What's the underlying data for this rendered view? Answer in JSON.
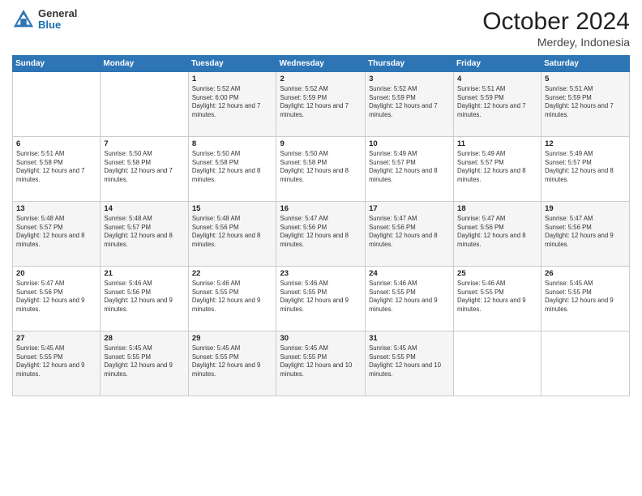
{
  "logo": {
    "general": "General",
    "blue": "Blue"
  },
  "title": "October 2024",
  "location": "Merdey, Indonesia",
  "days_header": [
    "Sunday",
    "Monday",
    "Tuesday",
    "Wednesday",
    "Thursday",
    "Friday",
    "Saturday"
  ],
  "weeks": [
    [
      {
        "day": "",
        "sunrise": "",
        "sunset": "",
        "daylight": ""
      },
      {
        "day": "",
        "sunrise": "",
        "sunset": "",
        "daylight": ""
      },
      {
        "day": "1",
        "sunrise": "Sunrise: 5:52 AM",
        "sunset": "Sunset: 6:00 PM",
        "daylight": "Daylight: 12 hours and 7 minutes."
      },
      {
        "day": "2",
        "sunrise": "Sunrise: 5:52 AM",
        "sunset": "Sunset: 5:59 PM",
        "daylight": "Daylight: 12 hours and 7 minutes."
      },
      {
        "day": "3",
        "sunrise": "Sunrise: 5:52 AM",
        "sunset": "Sunset: 5:59 PM",
        "daylight": "Daylight: 12 hours and 7 minutes."
      },
      {
        "day": "4",
        "sunrise": "Sunrise: 5:51 AM",
        "sunset": "Sunset: 5:59 PM",
        "daylight": "Daylight: 12 hours and 7 minutes."
      },
      {
        "day": "5",
        "sunrise": "Sunrise: 5:51 AM",
        "sunset": "Sunset: 5:59 PM",
        "daylight": "Daylight: 12 hours and 7 minutes."
      }
    ],
    [
      {
        "day": "6",
        "sunrise": "Sunrise: 5:51 AM",
        "sunset": "Sunset: 5:58 PM",
        "daylight": "Daylight: 12 hours and 7 minutes."
      },
      {
        "day": "7",
        "sunrise": "Sunrise: 5:50 AM",
        "sunset": "Sunset: 5:58 PM",
        "daylight": "Daylight: 12 hours and 7 minutes."
      },
      {
        "day": "8",
        "sunrise": "Sunrise: 5:50 AM",
        "sunset": "Sunset: 5:58 PM",
        "daylight": "Daylight: 12 hours and 8 minutes."
      },
      {
        "day": "9",
        "sunrise": "Sunrise: 5:50 AM",
        "sunset": "Sunset: 5:58 PM",
        "daylight": "Daylight: 12 hours and 8 minutes."
      },
      {
        "day": "10",
        "sunrise": "Sunrise: 5:49 AM",
        "sunset": "Sunset: 5:57 PM",
        "daylight": "Daylight: 12 hours and 8 minutes."
      },
      {
        "day": "11",
        "sunrise": "Sunrise: 5:49 AM",
        "sunset": "Sunset: 5:57 PM",
        "daylight": "Daylight: 12 hours and 8 minutes."
      },
      {
        "day": "12",
        "sunrise": "Sunrise: 5:49 AM",
        "sunset": "Sunset: 5:57 PM",
        "daylight": "Daylight: 12 hours and 8 minutes."
      }
    ],
    [
      {
        "day": "13",
        "sunrise": "Sunrise: 5:48 AM",
        "sunset": "Sunset: 5:57 PM",
        "daylight": "Daylight: 12 hours and 8 minutes."
      },
      {
        "day": "14",
        "sunrise": "Sunrise: 5:48 AM",
        "sunset": "Sunset: 5:57 PM",
        "daylight": "Daylight: 12 hours and 8 minutes."
      },
      {
        "day": "15",
        "sunrise": "Sunrise: 5:48 AM",
        "sunset": "Sunset: 5:56 PM",
        "daylight": "Daylight: 12 hours and 8 minutes."
      },
      {
        "day": "16",
        "sunrise": "Sunrise: 5:47 AM",
        "sunset": "Sunset: 5:56 PM",
        "daylight": "Daylight: 12 hours and 8 minutes."
      },
      {
        "day": "17",
        "sunrise": "Sunrise: 5:47 AM",
        "sunset": "Sunset: 5:56 PM",
        "daylight": "Daylight: 12 hours and 8 minutes."
      },
      {
        "day": "18",
        "sunrise": "Sunrise: 5:47 AM",
        "sunset": "Sunset: 5:56 PM",
        "daylight": "Daylight: 12 hours and 8 minutes."
      },
      {
        "day": "19",
        "sunrise": "Sunrise: 5:47 AM",
        "sunset": "Sunset: 5:56 PM",
        "daylight": "Daylight: 12 hours and 9 minutes."
      }
    ],
    [
      {
        "day": "20",
        "sunrise": "Sunrise: 5:47 AM",
        "sunset": "Sunset: 5:56 PM",
        "daylight": "Daylight: 12 hours and 9 minutes."
      },
      {
        "day": "21",
        "sunrise": "Sunrise: 5:46 AM",
        "sunset": "Sunset: 5:56 PM",
        "daylight": "Daylight: 12 hours and 9 minutes."
      },
      {
        "day": "22",
        "sunrise": "Sunrise: 5:46 AM",
        "sunset": "Sunset: 5:55 PM",
        "daylight": "Daylight: 12 hours and 9 minutes."
      },
      {
        "day": "23",
        "sunrise": "Sunrise: 5:46 AM",
        "sunset": "Sunset: 5:55 PM",
        "daylight": "Daylight: 12 hours and 9 minutes."
      },
      {
        "day": "24",
        "sunrise": "Sunrise: 5:46 AM",
        "sunset": "Sunset: 5:55 PM",
        "daylight": "Daylight: 12 hours and 9 minutes."
      },
      {
        "day": "25",
        "sunrise": "Sunrise: 5:46 AM",
        "sunset": "Sunset: 5:55 PM",
        "daylight": "Daylight: 12 hours and 9 minutes."
      },
      {
        "day": "26",
        "sunrise": "Sunrise: 5:45 AM",
        "sunset": "Sunset: 5:55 PM",
        "daylight": "Daylight: 12 hours and 9 minutes."
      }
    ],
    [
      {
        "day": "27",
        "sunrise": "Sunrise: 5:45 AM",
        "sunset": "Sunset: 5:55 PM",
        "daylight": "Daylight: 12 hours and 9 minutes."
      },
      {
        "day": "28",
        "sunrise": "Sunrise: 5:45 AM",
        "sunset": "Sunset: 5:55 PM",
        "daylight": "Daylight: 12 hours and 9 minutes."
      },
      {
        "day": "29",
        "sunrise": "Sunrise: 5:45 AM",
        "sunset": "Sunset: 5:55 PM",
        "daylight": "Daylight: 12 hours and 9 minutes."
      },
      {
        "day": "30",
        "sunrise": "Sunrise: 5:45 AM",
        "sunset": "Sunset: 5:55 PM",
        "daylight": "Daylight: 12 hours and 10 minutes."
      },
      {
        "day": "31",
        "sunrise": "Sunrise: 5:45 AM",
        "sunset": "Sunset: 5:55 PM",
        "daylight": "Daylight: 12 hours and 10 minutes."
      },
      {
        "day": "",
        "sunrise": "",
        "sunset": "",
        "daylight": ""
      },
      {
        "day": "",
        "sunrise": "",
        "sunset": "",
        "daylight": ""
      }
    ]
  ]
}
